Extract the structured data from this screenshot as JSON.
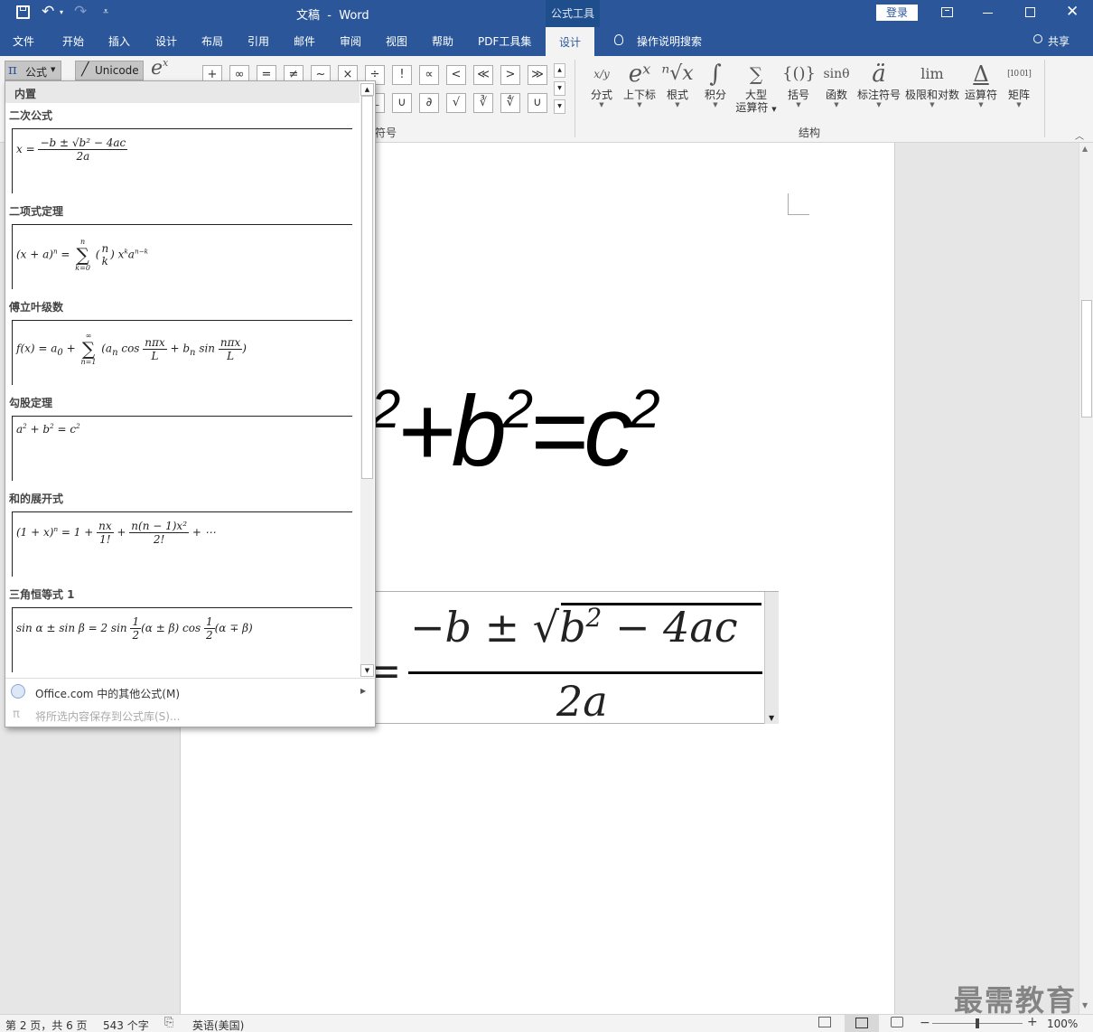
{
  "window": {
    "title": "文稿  -  Word",
    "context_tab": "公式工具",
    "login_label": "登录"
  },
  "tabs": [
    {
      "label": "文件"
    },
    {
      "label": "开始"
    },
    {
      "label": "插入"
    },
    {
      "label": "设计"
    },
    {
      "label": "布局"
    },
    {
      "label": "引用"
    },
    {
      "label": "邮件"
    },
    {
      "label": "审阅"
    },
    {
      "label": "视图"
    },
    {
      "label": "帮助"
    },
    {
      "label": "PDF工具集"
    },
    {
      "label": "设计",
      "active": true
    }
  ],
  "tell_me": "操作说明搜索",
  "share": "共享",
  "ribbon": {
    "equation_btn": "公式",
    "unicode_btn": "Unicode",
    "symbols_row1": [
      "+",
      "∞",
      "=",
      "≠",
      "~",
      "×",
      "÷",
      "!",
      "∝",
      "<",
      "≪",
      ">",
      "≫"
    ],
    "symbols_row2": [
      "⊥",
      "∪",
      "√",
      "∂",
      "∛",
      "∜",
      "∪"
    ],
    "symbols_group_label": "符号",
    "structures_group_label": "结构",
    "structures": [
      {
        "icon": "x/y",
        "label": "分式"
      },
      {
        "icon": "eˣ",
        "label": "上下标"
      },
      {
        "icon": "ⁿ√x",
        "label": "根式"
      },
      {
        "icon": "∫",
        "label": "积分"
      },
      {
        "icon": "∑",
        "label": "大型",
        "label2": "运算符"
      },
      {
        "icon": "{()}",
        "label": "括号"
      },
      {
        "icon": "sinθ",
        "label": "函数"
      },
      {
        "icon": "ä",
        "label": "标注符号"
      },
      {
        "icon": "lim",
        "label": "极限和对数"
      },
      {
        "icon": "Δ",
        "label": "运算符"
      },
      {
        "icon": "[10 01]",
        "label": "矩阵"
      }
    ]
  },
  "gallery": {
    "header": "内置",
    "items": [
      {
        "title": "二次公式"
      },
      {
        "title": "二项式定理"
      },
      {
        "title": "傅立叶级数"
      },
      {
        "title": "勾股定理"
      },
      {
        "title": "和的展开式"
      },
      {
        "title": "三角恒等式 1"
      }
    ],
    "more_link": "Office.com 中的其他公式(M)",
    "save_link": "将所选内容保存到公式库(S)..."
  },
  "status": {
    "page": "第 2 页，共 6 页",
    "words": "543 个字",
    "language": "英语(美国)",
    "zoom": "100%"
  },
  "watermark": "最需教育"
}
